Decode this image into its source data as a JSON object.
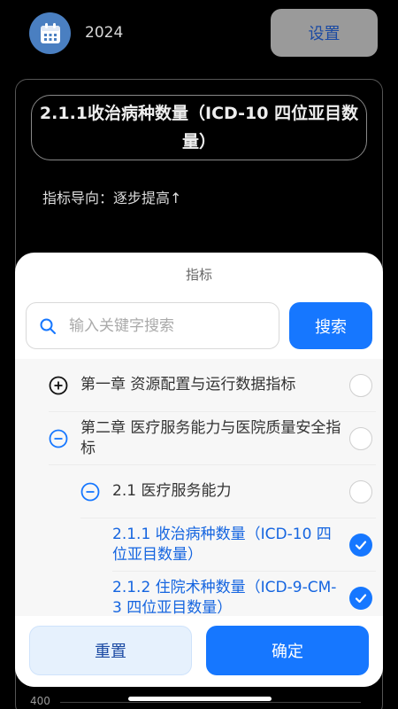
{
  "header": {
    "calendar_icon": "calendar-icon",
    "year": "2024",
    "settings_label": "设置"
  },
  "card": {
    "title": "2.1.1收治病种数量（ICD-10 四位亚目数量）",
    "direction": "指标导向：逐步提高↑",
    "axis_tick": "400"
  },
  "sheet": {
    "title": "指标",
    "search_placeholder": "输入关键字搜索",
    "search_label": "搜索",
    "items": [
      {
        "label": "第一章 资源配置与运行数据指标",
        "state": "collapsed",
        "checked": false
      },
      {
        "label": "第二章 医疗服务能力与医院质量安全指标",
        "state": "expanded",
        "checked": false
      },
      {
        "label": "2.1 医疗服务能力",
        "state": "expanded",
        "checked": false
      },
      {
        "label": "2.1.1 收治病种数量（ICD-10 四位亚目数量）",
        "state": "leaf",
        "checked": true
      },
      {
        "label": "2.1.2 住院术种数量（ICD-9-CM-3 四位亚目数量）",
        "state": "leaf",
        "checked": true
      }
    ],
    "reset_label": "重置",
    "confirm_label": "确定"
  },
  "colors": {
    "accent": "#1677ff",
    "accent_text": "#1565e0",
    "reset_bg": "#e6f1fd"
  }
}
